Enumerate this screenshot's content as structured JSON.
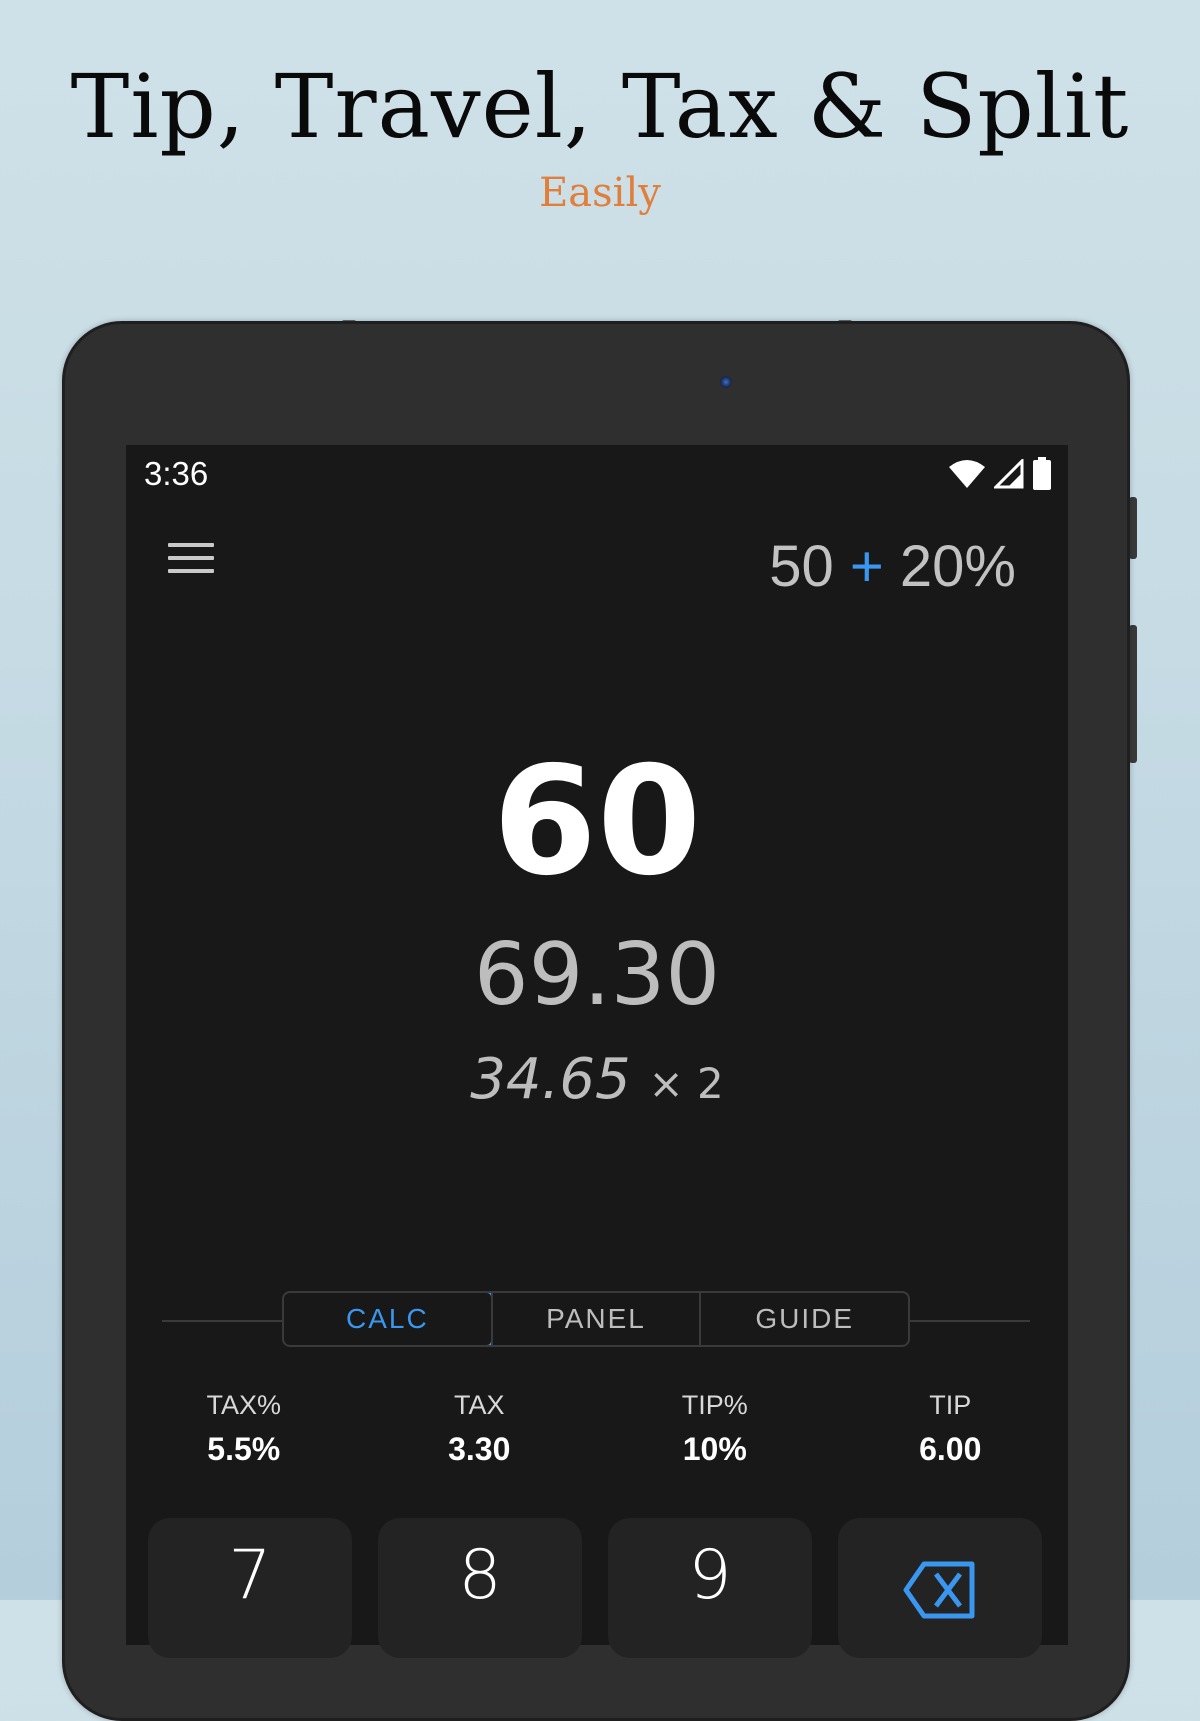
{
  "promo": {
    "headline": "Tip, Travel, Tax & Split",
    "subheadline": "Easily",
    "accent_color": "#e07f3c"
  },
  "status_bar": {
    "time": "3:36",
    "icons": [
      "wifi-icon",
      "signal-icon",
      "battery-icon"
    ]
  },
  "header": {
    "menu_icon": "hamburger-menu-icon",
    "expression": {
      "operand": "50",
      "operator": "+",
      "percent": "20%"
    },
    "operator_color": "#3a97f0"
  },
  "display": {
    "result": "60",
    "total": "69.30",
    "split_amount": "34.65",
    "split_multiplier": "× 2"
  },
  "tabs": [
    {
      "label": "CALC",
      "active": true
    },
    {
      "label": "PANEL",
      "active": false
    },
    {
      "label": "GUIDE",
      "active": false
    }
  ],
  "stats": [
    {
      "label": "TAX%",
      "value": "5.5%"
    },
    {
      "label": "TAX",
      "value": "3.30"
    },
    {
      "label": "TIP%",
      "value": "10%"
    },
    {
      "label": "TIP",
      "value": "6.00"
    }
  ],
  "keypad": {
    "keys": [
      "7",
      "8",
      "9"
    ],
    "backspace_icon": "backspace-icon"
  }
}
